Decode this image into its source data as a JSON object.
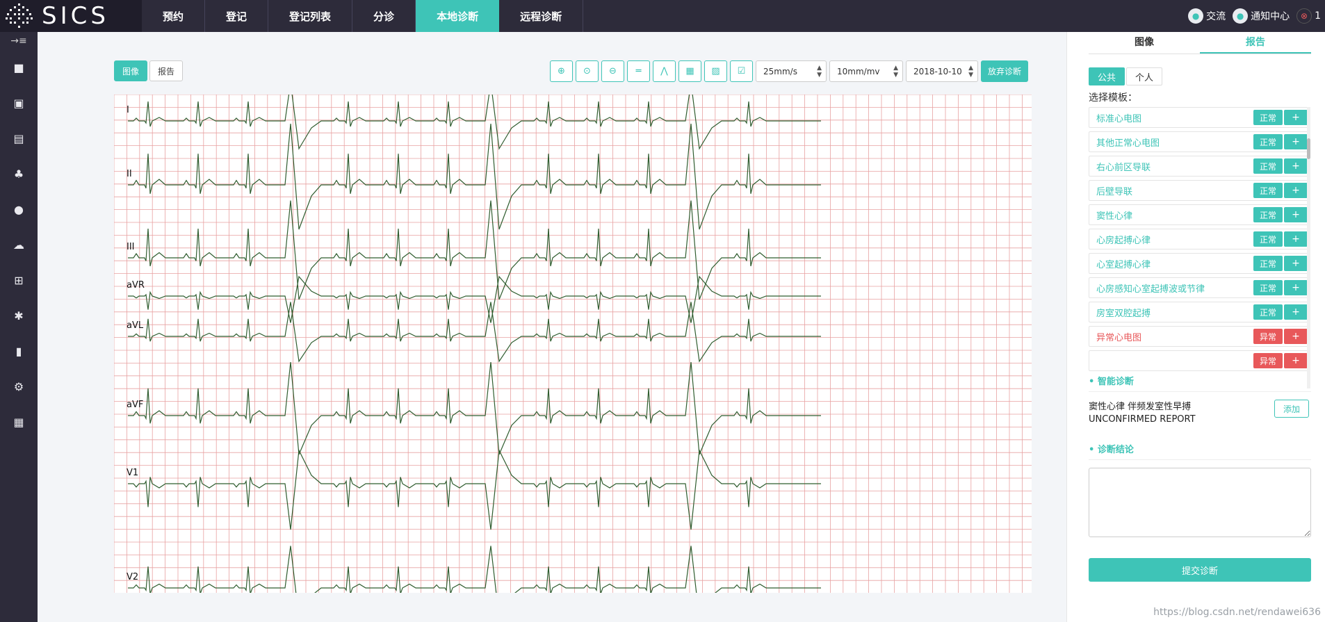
{
  "app": {
    "brand": "SICS",
    "nav": [
      {
        "label": "预约",
        "active": false
      },
      {
        "label": "登记",
        "active": false
      },
      {
        "label": "登记列表",
        "active": false
      },
      {
        "label": "分诊",
        "active": false
      },
      {
        "label": "本地诊断",
        "active": true
      },
      {
        "label": "远程诊断",
        "active": false
      }
    ],
    "top_right": {
      "chat_label": "交流",
      "notice_label": "通知中心",
      "user_count": "1"
    }
  },
  "sidebar": {
    "icons": [
      "collapse-icon",
      "briefcase-icon",
      "contact-card-icon",
      "document-icon",
      "group-icon",
      "user-icon",
      "cloud-icon",
      "org-tree-icon",
      "bug-icon",
      "bar-chart-icon",
      "settings-icon",
      "calendar-icon"
    ]
  },
  "viewer": {
    "mode_tabs": [
      {
        "label": "图像",
        "active": true
      },
      {
        "label": "报告",
        "active": false
      }
    ],
    "tools": [
      "zoom-in-icon",
      "zoom-reset-icon",
      "zoom-out-icon",
      "ruler-icon",
      "wave-icon",
      "grid-icon",
      "hatch-icon",
      "check-icon"
    ],
    "speed": "25mm/s",
    "gain": "10mm/mv",
    "date": "2018-10-10",
    "abandon_label": "放弃诊断",
    "leads": [
      "I",
      "II",
      "III",
      "aVR",
      "aVL",
      "aVF",
      "V1",
      "V2"
    ]
  },
  "right_panel": {
    "tabs": [
      {
        "label": "图像",
        "active": false
      },
      {
        "label": "报告",
        "active": true
      }
    ],
    "scope_tabs": [
      {
        "label": "公共",
        "active": true
      },
      {
        "label": "个人",
        "active": false
      }
    ],
    "template_label": "选择模板：",
    "templates": [
      {
        "name": "标准心电图",
        "tag": "正常",
        "abnormal": false
      },
      {
        "name": "其他正常心电图",
        "tag": "正常",
        "abnormal": false
      },
      {
        "name": "右心前区导联",
        "tag": "正常",
        "abnormal": false
      },
      {
        "name": "后壁导联",
        "tag": "正常",
        "abnormal": false
      },
      {
        "name": "窦性心律",
        "tag": "正常",
        "abnormal": false
      },
      {
        "name": "心房起搏心律",
        "tag": "正常",
        "abnormal": false
      },
      {
        "name": "心室起搏心律",
        "tag": "正常",
        "abnormal": false
      },
      {
        "name": "心房感知心室起搏波或节律",
        "tag": "正常",
        "abnormal": false
      },
      {
        "name": "房室双腔起搏",
        "tag": "正常",
        "abnormal": false
      },
      {
        "name": "异常心电图",
        "tag": "异常",
        "abnormal": true
      },
      {
        "name": "",
        "tag": "异常",
        "abnormal": true
      }
    ],
    "smart_title": "智能诊断",
    "smart_line1": "窦性心律 伴频发室性早搏",
    "smart_line2": "UNCONFIRMED REPORT",
    "add_label": "添加",
    "conclusion_title": "诊断结论",
    "conclusion_value": "",
    "submit_label": "提交诊断"
  },
  "watermark": "https://blog.csdn.net/rendawei636",
  "colors": {
    "accent": "#3ec4b7",
    "danger": "#e8585a",
    "dark": "#2d2b3a",
    "grid_line": "#e8a1a1",
    "trace": "#2f5d2f"
  }
}
